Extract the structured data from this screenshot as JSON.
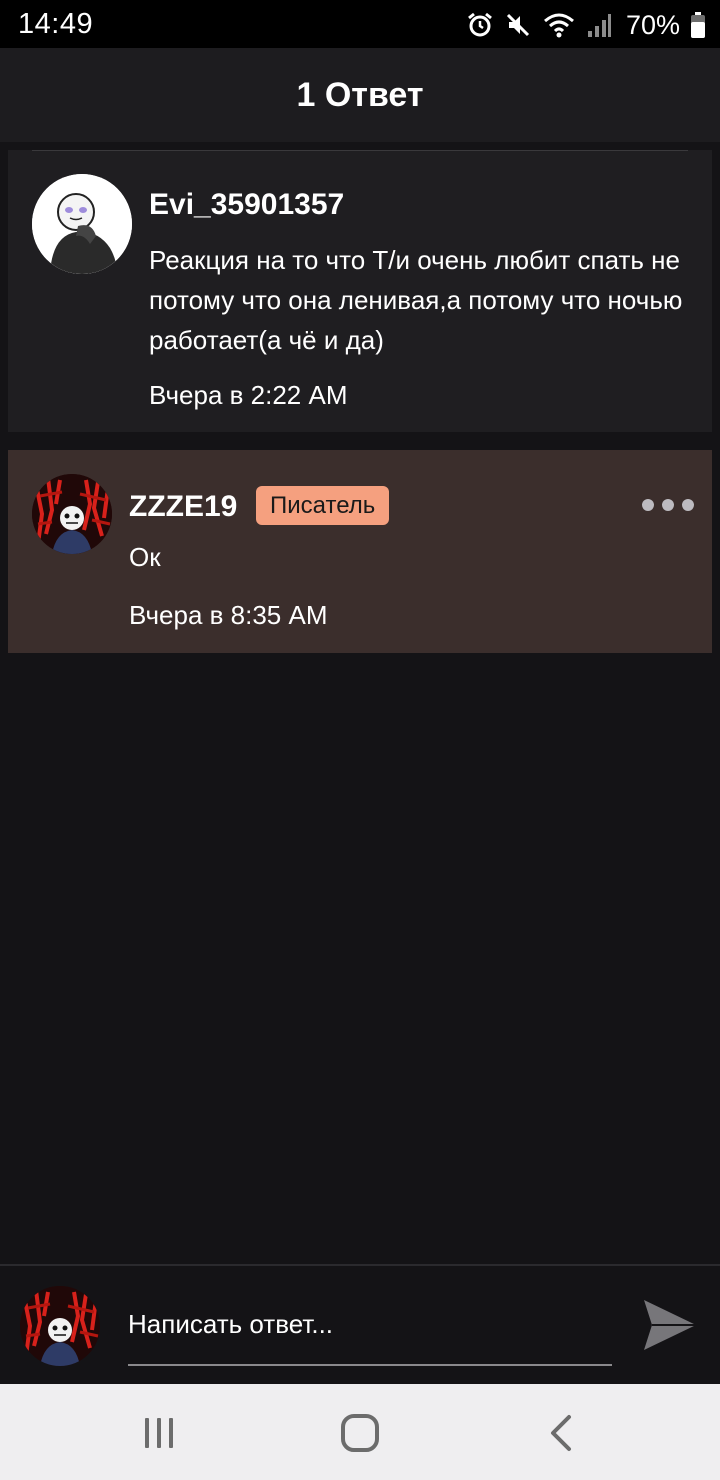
{
  "status_bar": {
    "time": "14:49",
    "battery": "70%",
    "icons": [
      "alarm-icon",
      "mute-icon",
      "wifi-icon",
      "signal-icon",
      "battery-icon"
    ]
  },
  "header": {
    "title": "1 Ответ"
  },
  "parent_comment": {
    "author": "Evi_35901357",
    "text": "Реакция на то что Т/и очень любит спать не потому что она ленивая,а потому что ночью работает(а чё и да)",
    "time": "Вчера в 2:22 AM"
  },
  "reply": {
    "author": "ZZZE19",
    "badge": "Писатель",
    "text": "Ок",
    "time": "Вчера в 8:35 AM"
  },
  "composer": {
    "placeholder": "Написать ответ..."
  },
  "colors": {
    "background": "#141316",
    "header": "#1d1c1f",
    "reply_highlight": "#3b2e2c",
    "badge": "#f5a07f",
    "navbar": "#efeef0"
  }
}
